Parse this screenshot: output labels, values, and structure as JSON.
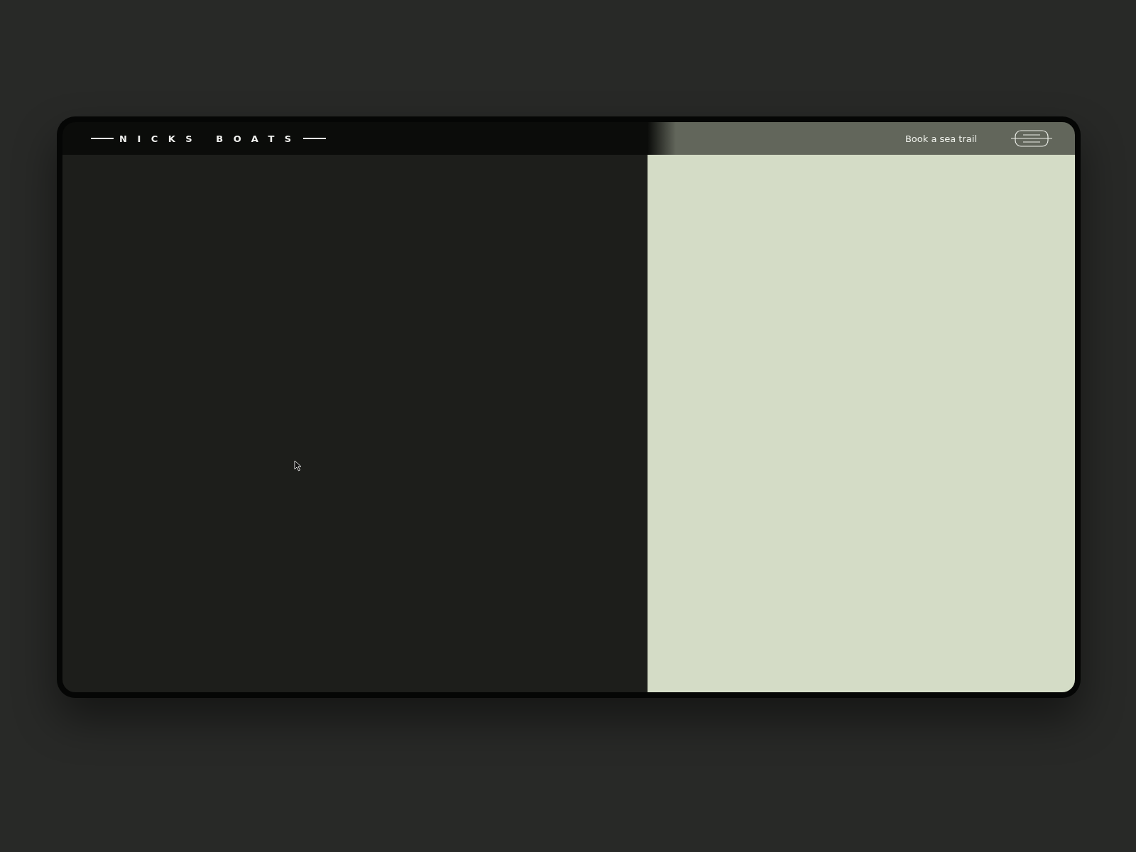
{
  "header": {
    "logo": "NICKS BOATS",
    "cta": "Book a sea trail"
  },
  "pointer": {
    "visible": true
  }
}
